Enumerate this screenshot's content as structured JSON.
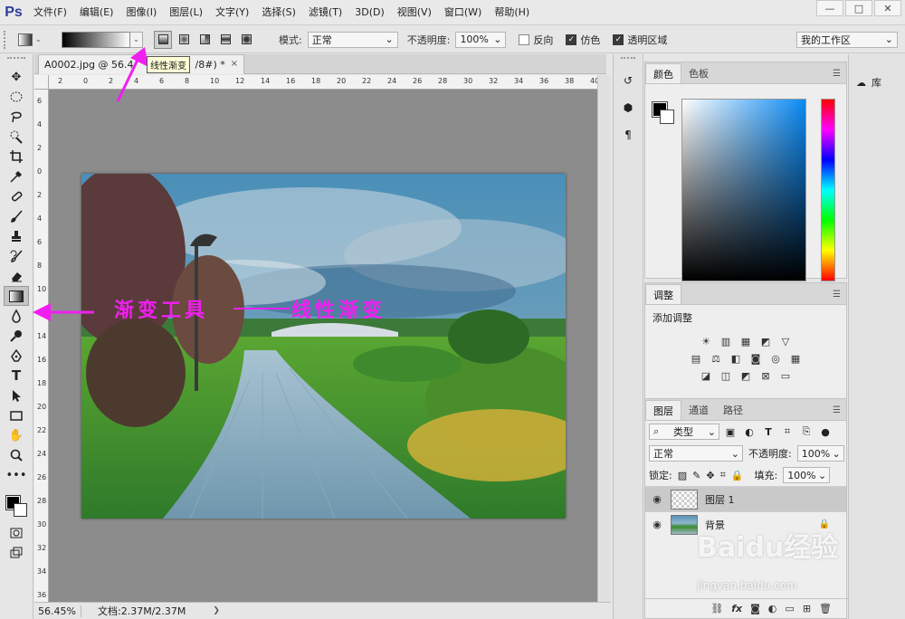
{
  "app": {
    "logo": "Ps"
  },
  "menu": [
    "文件(F)",
    "编辑(E)",
    "图像(I)",
    "图层(L)",
    "文字(Y)",
    "选择(S)",
    "滤镜(T)",
    "3D(D)",
    "视图(V)",
    "窗口(W)",
    "帮助(H)"
  ],
  "window_controls": {
    "minimize": "—",
    "maximize": "□",
    "close": "✕"
  },
  "options": {
    "mode_label": "模式:",
    "mode_value": "正常",
    "opacity_label": "不透明度:",
    "opacity_value": "100%",
    "reverse_label": "反向",
    "dither_label": "仿色",
    "transparency_label": "透明区域",
    "workspace": "我的工作区"
  },
  "tooltip": "线性渐变",
  "document": {
    "tab_title": "A0002.jpg @ 56.4",
    "tab_suffix": "/8#) *",
    "close": "×"
  },
  "status": {
    "zoom": "56.45%",
    "doc_size": "文档:2.37M/2.37M"
  },
  "annotations": {
    "tool": "渐变工具",
    "mode": "线性渐变"
  },
  "ruler_h": [
    "2",
    "0",
    "2",
    "4",
    "6",
    "8",
    "10",
    "12",
    "14",
    "16",
    "18",
    "20",
    "22",
    "24",
    "26",
    "28",
    "30",
    "32",
    "34",
    "36",
    "38",
    "40"
  ],
  "ruler_v": [
    "6",
    "4",
    "2",
    "0",
    "2",
    "4",
    "6",
    "8",
    "10",
    "12",
    "14",
    "16",
    "18",
    "20",
    "22",
    "24",
    "26",
    "28",
    "30",
    "32",
    "34",
    "36"
  ],
  "color_panel": {
    "tabs": [
      "颜色",
      "色板"
    ]
  },
  "adjust_panel": {
    "tab": "调整",
    "title": "添加调整"
  },
  "layers_panel": {
    "tabs": [
      "图层",
      "通道",
      "路径"
    ],
    "filter_type": "类型",
    "blend_mode": "正常",
    "opacity_label": "不透明度:",
    "opacity_value": "100%",
    "lock_label": "锁定:",
    "fill_label": "填充:",
    "fill_value": "100%",
    "layers": [
      {
        "name": "图层 1",
        "selected": true,
        "kind": "transparent"
      },
      {
        "name": "背景",
        "selected": false,
        "kind": "image"
      }
    ]
  },
  "library": {
    "label": "库"
  },
  "watermark": {
    "main": "Baidu经验",
    "sub": "jingyan.baidu.com"
  }
}
